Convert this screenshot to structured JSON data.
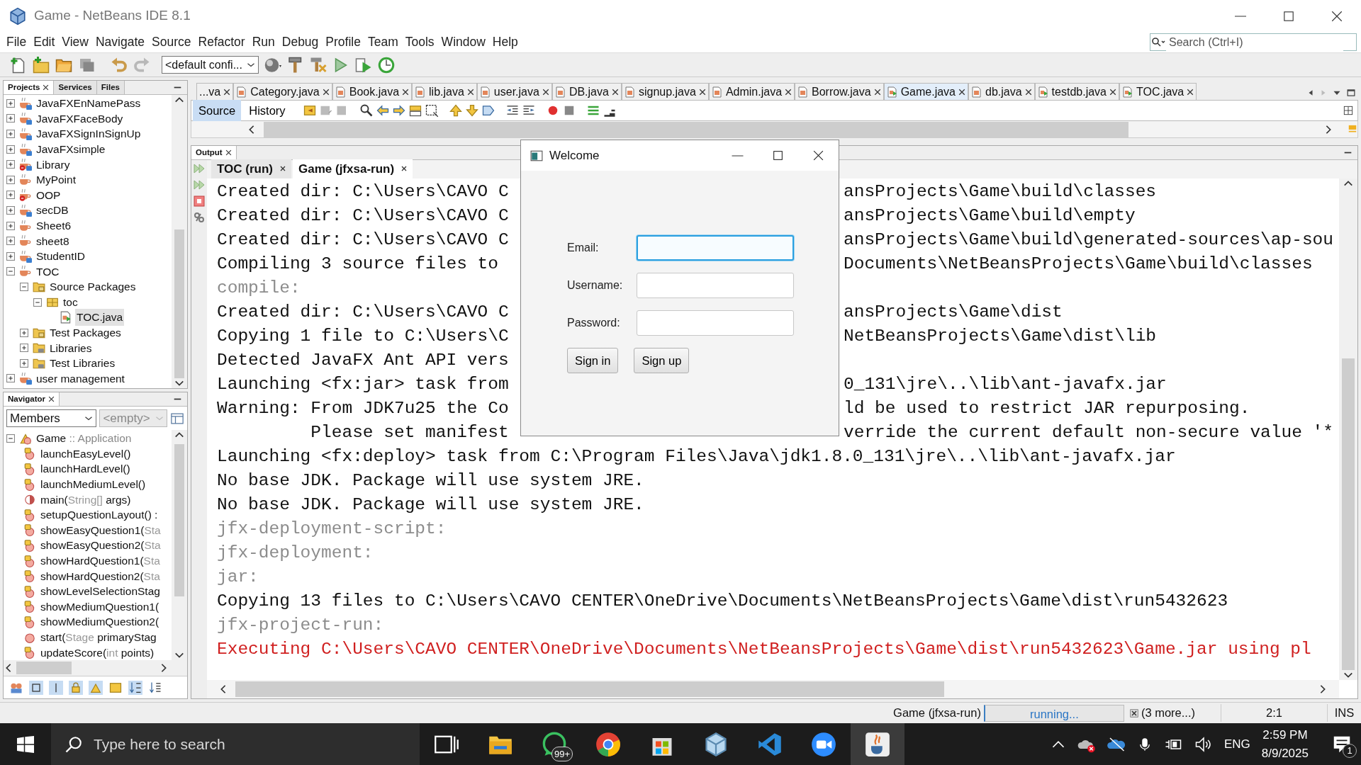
{
  "window": {
    "title": "Game - NetBeans IDE 8.1"
  },
  "menu": [
    "File",
    "Edit",
    "View",
    "Navigate",
    "Source",
    "Refactor",
    "Run",
    "Debug",
    "Profile",
    "Team",
    "Tools",
    "Window",
    "Help"
  ],
  "search": {
    "placeholder": "Search (Ctrl+I)"
  },
  "toolbar": {
    "configuration": "<default confi..."
  },
  "projects_panel": {
    "tabs": [
      {
        "label": "Projects",
        "selected": true
      },
      {
        "label": "Services",
        "selected": false
      },
      {
        "label": "Files",
        "selected": false
      }
    ],
    "tree": [
      {
        "label": "JavaFXEnNamePass",
        "kind": "project",
        "fx": true,
        "error": false,
        "expanded": false,
        "selected": false
      },
      {
        "label": "JavaFXFaceBody",
        "kind": "project",
        "fx": true,
        "error": false,
        "expanded": false,
        "selected": false
      },
      {
        "label": "JavaFXSignInSignUp",
        "kind": "project",
        "fx": true,
        "error": false,
        "expanded": false,
        "selected": false
      },
      {
        "label": "JavaFXsimple",
        "kind": "project",
        "fx": true,
        "error": false,
        "expanded": false,
        "selected": false
      },
      {
        "label": "Library",
        "kind": "project",
        "fx": true,
        "error": true,
        "expanded": false,
        "selected": false
      },
      {
        "label": "MyPoint",
        "kind": "project",
        "fx": false,
        "error": false,
        "expanded": false,
        "selected": false
      },
      {
        "label": "OOP",
        "kind": "project",
        "fx": false,
        "error": true,
        "expanded": false,
        "selected": false
      },
      {
        "label": "secDB",
        "kind": "project",
        "fx": true,
        "error": false,
        "expanded": false,
        "selected": false
      },
      {
        "label": "Sheet6",
        "kind": "project",
        "fx": false,
        "error": false,
        "expanded": false,
        "selected": false
      },
      {
        "label": "sheet8",
        "kind": "project",
        "fx": false,
        "error": false,
        "expanded": false,
        "selected": false
      },
      {
        "label": "StudentID",
        "kind": "project",
        "fx": true,
        "error": false,
        "expanded": false,
        "selected": false
      },
      {
        "label": "TOC",
        "kind": "project",
        "fx": false,
        "error": false,
        "expanded": true,
        "selected": false,
        "children": [
          {
            "label": "Source Packages",
            "kind": "package-folder",
            "expanded": true,
            "selected": false,
            "children": [
              {
                "label": "toc",
                "kind": "package",
                "expanded": true,
                "selected": false,
                "children": [
                  {
                    "label": "TOC.java",
                    "kind": "java-file",
                    "selected": true
                  }
                ]
              }
            ]
          },
          {
            "label": "Test Packages",
            "kind": "package-folder",
            "expanded": false,
            "selected": false
          },
          {
            "label": "Libraries",
            "kind": "library-folder",
            "expanded": false,
            "selected": false
          },
          {
            "label": "Test Libraries",
            "kind": "library-folder",
            "expanded": false,
            "selected": false
          }
        ]
      },
      {
        "label": "user management",
        "kind": "project",
        "fx": true,
        "error": false,
        "expanded": false,
        "selected": false
      }
    ]
  },
  "navigator": {
    "title": "Navigator",
    "view": "Members",
    "filter": "<empty>",
    "root": {
      "name": "Game",
      "type": ":: Application",
      "expanded": true
    },
    "members": [
      {
        "kind": "private",
        "name": "launchEasyLevel()"
      },
      {
        "kind": "private",
        "name": "launchHardLevel()"
      },
      {
        "kind": "private",
        "name": "launchMediumLevel()"
      },
      {
        "kind": "static",
        "name": "main(",
        "type": "String[]",
        "rest": " args)"
      },
      {
        "kind": "private",
        "name": "setupQuestionLayout() :"
      },
      {
        "kind": "private",
        "name": "showEasyQuestion1(",
        "type": "Sta"
      },
      {
        "kind": "private",
        "name": "showEasyQuestion2(",
        "type": "Sta"
      },
      {
        "kind": "private",
        "name": "showHardQuestion1(",
        "type": "Sta"
      },
      {
        "kind": "private",
        "name": "showHardQuestion2(",
        "type": "Sta"
      },
      {
        "kind": "private",
        "name": "showLevelSelectionStag"
      },
      {
        "kind": "private",
        "name": "showMediumQuestion1("
      },
      {
        "kind": "private",
        "name": "showMediumQuestion2("
      },
      {
        "kind": "public",
        "name": "start(",
        "type": "Stage",
        "rest": " primaryStag"
      },
      {
        "kind": "private",
        "name": "updateScore(",
        "type": "int",
        "rest": " points)"
      }
    ]
  },
  "editor": {
    "tabs": [
      {
        "label": "...va",
        "selected": false
      },
      {
        "label": "Category.java",
        "selected": false,
        "runnable": false
      },
      {
        "label": "Book.java",
        "selected": false,
        "runnable": false
      },
      {
        "label": "lib.java",
        "selected": false,
        "runnable": false
      },
      {
        "label": "user.java",
        "selected": false,
        "runnable": false
      },
      {
        "label": "DB.java",
        "selected": false,
        "runnable": false
      },
      {
        "label": "signup.java",
        "selected": false,
        "runnable": false
      },
      {
        "label": "Admin.java",
        "selected": false,
        "runnable": false
      },
      {
        "label": "Borrow.java",
        "selected": false,
        "runnable": false
      },
      {
        "label": "Game.java",
        "selected": true,
        "runnable": true
      },
      {
        "label": "db.java",
        "selected": false,
        "runnable": false
      },
      {
        "label": "testdb.java",
        "selected": false,
        "runnable": true
      },
      {
        "label": "TOC.java",
        "selected": false,
        "runnable": true
      }
    ],
    "views": [
      {
        "label": "Source",
        "selected": true
      },
      {
        "label": "History",
        "selected": false
      }
    ]
  },
  "output": {
    "title": "Output",
    "tabs": [
      {
        "label": "TOC (run)",
        "selected": false
      },
      {
        "label": "Game (jfxsa-run)",
        "selected": true
      }
    ],
    "lines": [
      {
        "kind": "normal",
        "text": "Created dir: C:\\Users\\CAVO C",
        "tail": "ansProjects\\Game\\build\\classes"
      },
      {
        "kind": "normal",
        "text": "Created dir: C:\\Users\\CAVO C",
        "tail": "ansProjects\\Game\\build\\empty"
      },
      {
        "kind": "normal",
        "text": "Created dir: C:\\Users\\CAVO C",
        "tail": "ansProjects\\Game\\build\\generated-sources\\ap-sou"
      },
      {
        "kind": "normal",
        "text": "Compiling 3 source files to",
        "tail": "Documents\\NetBeansProjects\\Game\\build\\classes"
      },
      {
        "kind": "target",
        "text": "compile:"
      },
      {
        "kind": "normal",
        "text": "Created dir: C:\\Users\\CAVO C",
        "tail": "ansProjects\\Game\\dist"
      },
      {
        "kind": "normal",
        "text": "Copying 1 file to C:\\Users\\C",
        "tail": "NetBeansProjects\\Game\\dist\\lib"
      },
      {
        "kind": "normal",
        "text": "Detected JavaFX Ant API vers"
      },
      {
        "kind": "normal",
        "text": "Launching <fx:jar> task from",
        "tail": "0_131\\jre\\..\\lib\\ant-javafx.jar"
      },
      {
        "kind": "normal",
        "text": "Warning: From JDK7u25 the Co",
        "tail": "ld be used to restrict JAR repurposing."
      },
      {
        "kind": "normal",
        "text": "         Please set manifest",
        "tail": "verride the current default non-secure value '*"
      },
      {
        "kind": "normal",
        "text": "Launching <fx:deploy> task from C:\\Program Files\\Java\\jdk1.8.0_131\\jre\\..\\lib\\ant-javafx.jar"
      },
      {
        "kind": "normal",
        "text": "No base JDK. Package will use system JRE."
      },
      {
        "kind": "normal",
        "text": "No base JDK. Package will use system JRE."
      },
      {
        "kind": "target",
        "text": "jfx-deployment-script:"
      },
      {
        "kind": "target",
        "text": "jfx-deployment:"
      },
      {
        "kind": "target",
        "text": "jar:"
      },
      {
        "kind": "normal",
        "text": "Copying 13 files to C:\\Users\\CAVO CENTER\\OneDrive\\Documents\\NetBeansProjects\\Game\\dist\\run5432623"
      },
      {
        "kind": "target",
        "text": "jfx-project-run:"
      },
      {
        "kind": "error",
        "text": "Executing C:\\Users\\CAVO CENTER\\OneDrive\\Documents\\NetBeansProjects\\Game\\dist\\run5432623\\Game.jar using pl"
      }
    ]
  },
  "dialog": {
    "title": "Welcome",
    "fields": [
      {
        "label": "Email:",
        "focused": true
      },
      {
        "label": "Username:",
        "focused": false
      },
      {
        "label": "Password:",
        "focused": false
      }
    ],
    "buttons": [
      "Sign in",
      "Sign up"
    ]
  },
  "status_bar": {
    "task": "Game (jfxsa-run)",
    "progress": "running...",
    "more": "(3 more...)",
    "position": "2:1",
    "mode": "INS"
  },
  "taskbar": {
    "search_placeholder": "Type here to search",
    "apps": [
      {
        "kind": "task-view",
        "active": false
      },
      {
        "kind": "explorer",
        "active": false
      },
      {
        "kind": "whatsapp",
        "active": false,
        "badge": "99+"
      },
      {
        "kind": "chrome",
        "active": false
      },
      {
        "kind": "store",
        "active": false
      },
      {
        "kind": "cube",
        "active": false
      },
      {
        "kind": "vscode",
        "active": false
      },
      {
        "kind": "zoom",
        "active": false
      },
      {
        "kind": "java",
        "active": true
      }
    ],
    "language": "ENG",
    "time": "2:59 PM",
    "date": "8/9/2025",
    "notifications": "1"
  }
}
